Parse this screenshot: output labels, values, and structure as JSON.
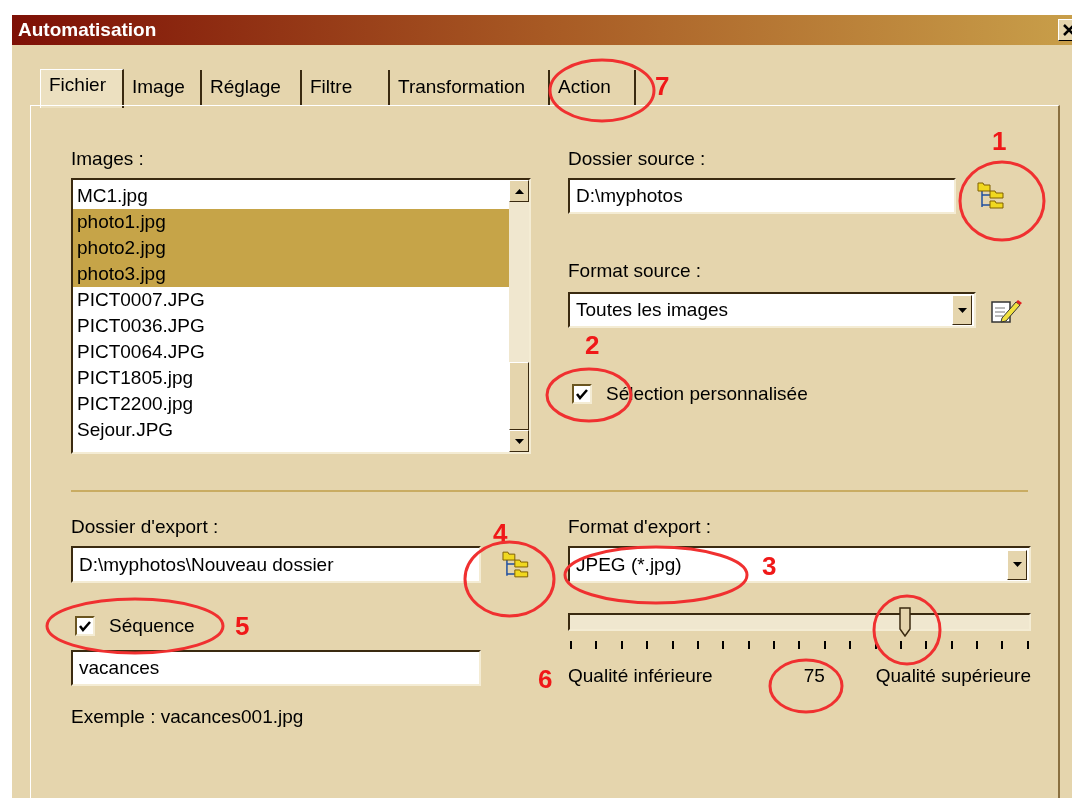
{
  "window": {
    "title": "Automatisation"
  },
  "tabs": [
    {
      "label": "Fichier",
      "selected": true
    },
    {
      "label": "Image",
      "selected": false
    },
    {
      "label": "Réglage",
      "selected": false
    },
    {
      "label": "Filtre",
      "selected": false
    },
    {
      "label": "Transformation",
      "selected": false
    },
    {
      "label": "Action",
      "selected": false
    }
  ],
  "images": {
    "label": "Images :",
    "items": [
      {
        "name": "MC1.jpg",
        "selected": false
      },
      {
        "name": "photo1.jpg",
        "selected": true
      },
      {
        "name": "photo2.jpg",
        "selected": true
      },
      {
        "name": "photo3.jpg",
        "selected": true
      },
      {
        "name": "PICT0007.JPG",
        "selected": false
      },
      {
        "name": "PICT0036.JPG",
        "selected": false
      },
      {
        "name": "PICT0064.JPG",
        "selected": false
      },
      {
        "name": "PICT1805.jpg",
        "selected": false
      },
      {
        "name": "PICT2200.jpg",
        "selected": false
      },
      {
        "name": "Sejour.JPG",
        "selected": false
      }
    ]
  },
  "source_folder": {
    "label": "Dossier source :",
    "value": "D:\\myphotos"
  },
  "source_format": {
    "label": "Format source :",
    "value": "Toutes les images"
  },
  "custom_selection": {
    "label": "Sélection personnalisée",
    "checked": true
  },
  "export_folder": {
    "label": "Dossier d'export :",
    "value": "D:\\myphotos\\Nouveau dossier"
  },
  "sequence": {
    "label": "Séquence",
    "checked": true,
    "value": "vacances"
  },
  "example": "Exemple : vacances001.jpg",
  "export_format": {
    "label": "Format d'export :",
    "value": "JPEG (*.jpg)"
  },
  "quality": {
    "level": 0.73,
    "min_label": "Qualité inférieure",
    "reading": "75",
    "max_label": "Qualité supérieure"
  },
  "annotations": [
    {
      "number": "1"
    },
    {
      "number": "2"
    },
    {
      "number": "3"
    },
    {
      "number": "4"
    },
    {
      "number": "5"
    },
    {
      "number": "6"
    },
    {
      "number": "7"
    }
  ]
}
